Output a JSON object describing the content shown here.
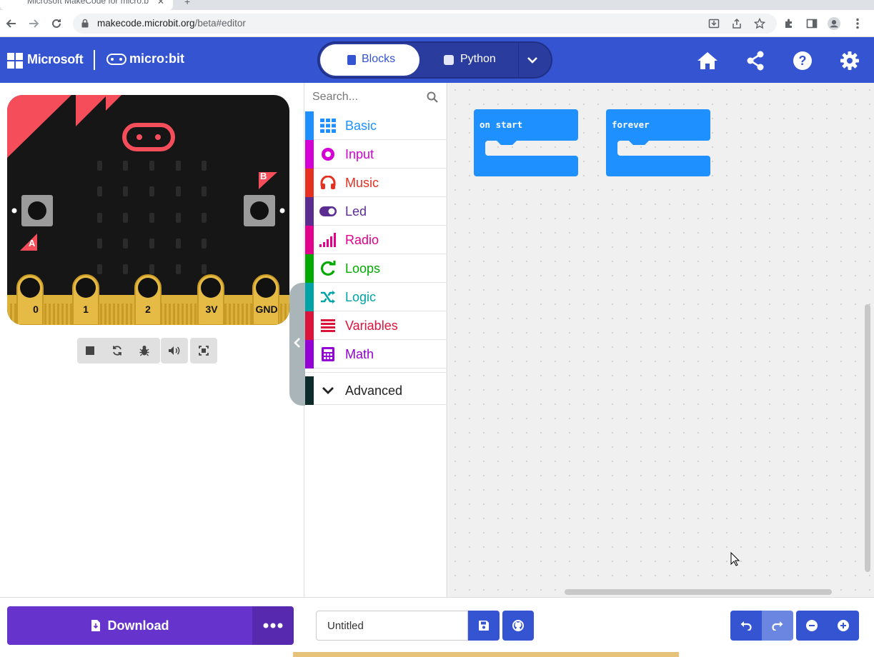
{
  "browser": {
    "tab_title": "Microsoft MakeCode for micro:bit",
    "url_host": "makecode.microbit.org",
    "url_path": "/beta#editor"
  },
  "header": {
    "microsoft": "Microsoft",
    "microbit": "micro:bit",
    "blocks_label": "Blocks",
    "python_label": "Python"
  },
  "simulator": {
    "button_a": "A",
    "button_b": "B",
    "pins": [
      "0",
      "1",
      "2",
      "3V",
      "GND"
    ]
  },
  "toolbox": {
    "search_placeholder": "Search...",
    "categories": [
      {
        "label": "Basic",
        "color": "#1e90ff"
      },
      {
        "label": "Input",
        "color": "#d400d4"
      },
      {
        "label": "Music",
        "color": "#e63022"
      },
      {
        "label": "Led",
        "color": "#5c2d91"
      },
      {
        "label": "Radio",
        "color": "#e3008c"
      },
      {
        "label": "Loops",
        "color": "#00aa00"
      },
      {
        "label": "Logic",
        "color": "#00a4a6"
      },
      {
        "label": "Variables",
        "color": "#dc143c"
      },
      {
        "label": "Math",
        "color": "#9400d3"
      }
    ],
    "advanced": "Advanced"
  },
  "workspace": {
    "blocks": [
      {
        "label": "on start"
      },
      {
        "label": "forever"
      }
    ],
    "block_color": "#1e90ff"
  },
  "bottom": {
    "download_label": "Download",
    "project_name": "Untitled"
  }
}
